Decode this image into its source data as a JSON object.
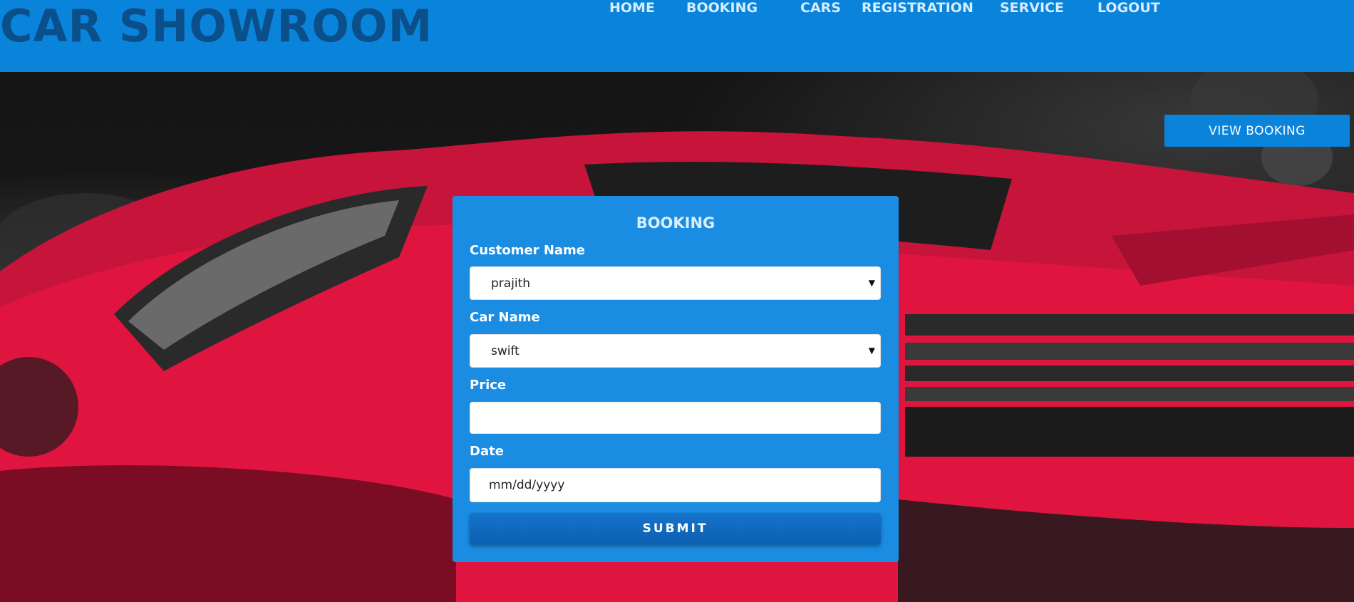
{
  "header": {
    "brand": "CAR SHOWROOM",
    "nav": [
      "HOME",
      "BOOKING",
      "CARS",
      "REGISTRATION",
      "SERVICE",
      "LOGOUT"
    ]
  },
  "hero": {
    "background_image": "red sports car",
    "view_booking_label": "VIEW BOOKING"
  },
  "form": {
    "title": "BOOKING",
    "customer_label": "Customer Name",
    "customer_value": "prajith",
    "car_label": "Car Name",
    "car_value": "swift",
    "price_label": "Price",
    "price_value": "",
    "date_label": "Date",
    "date_placeholder": "mm/dd/yyyy",
    "submit_label": "SUBMIT"
  },
  "colors": {
    "header_bg": "#0a84db",
    "brand_text": "#0b4f8a",
    "panel_bg": "#1a8de3",
    "submit_bg": "#0c5fb0",
    "car_red": "#e0153f"
  }
}
